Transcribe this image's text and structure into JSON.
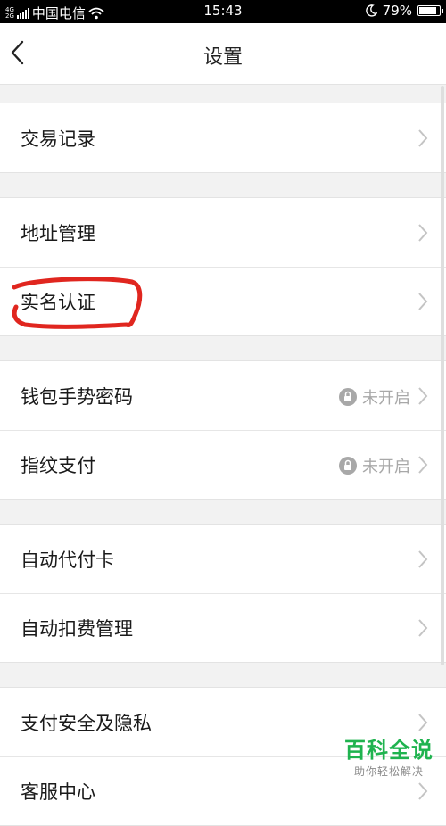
{
  "status_bar": {
    "network_top": "4G",
    "network_bottom": "2G",
    "carrier": "中国电信",
    "time": "15:43",
    "battery": "79%"
  },
  "header": {
    "title": "设置"
  },
  "groups": [
    {
      "items": [
        {
          "label": "交易记录"
        }
      ]
    },
    {
      "items": [
        {
          "label": "地址管理"
        },
        {
          "label": "实名认证"
        }
      ]
    },
    {
      "items": [
        {
          "label": "钱包手势密码",
          "status": "未开启"
        },
        {
          "label": "指纹支付",
          "status": "未开启"
        }
      ]
    },
    {
      "items": [
        {
          "label": "自动代付卡"
        },
        {
          "label": "自动扣费管理"
        }
      ]
    },
    {
      "items": [
        {
          "label": "支付安全及隐私"
        },
        {
          "label": "客服中心"
        }
      ]
    }
  ],
  "watermark": {
    "title": "百科全说",
    "subtitle": "助你轻松解决"
  },
  "colors": {
    "highlight_circle": "#e0261f",
    "watermark_green": "#1fb34f"
  }
}
